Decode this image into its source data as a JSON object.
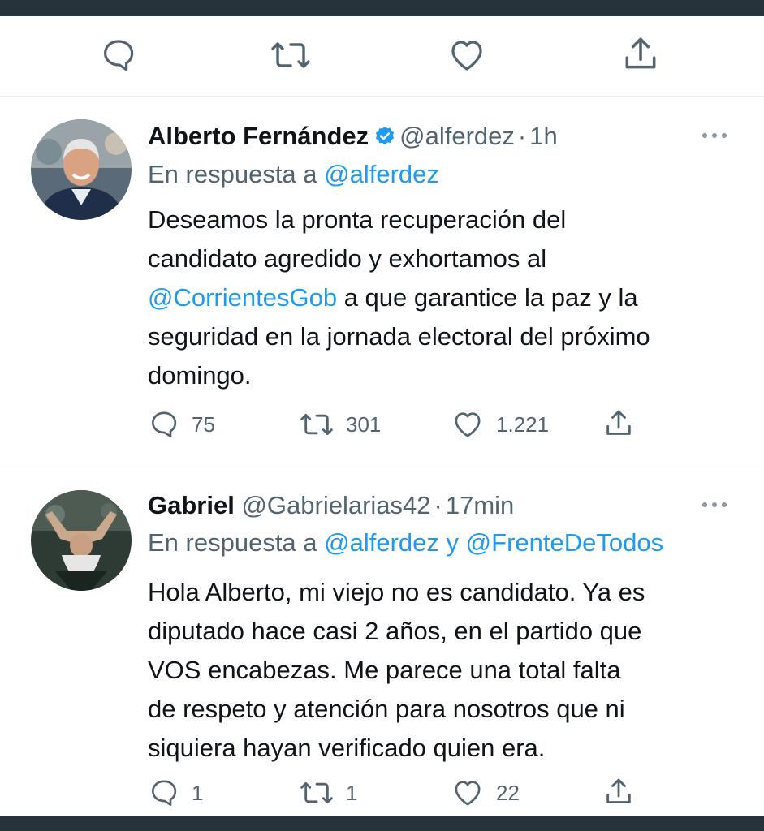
{
  "top_actions": {
    "icons": [
      "reply-icon",
      "retweet-icon",
      "like-icon",
      "share-icon"
    ]
  },
  "tweets": [
    {
      "author_name": "Alberto Fernández",
      "verified": true,
      "handle": "@alferdez",
      "separator": "·",
      "time": "1h",
      "reply_prefix": "En respuesta a",
      "reply_to": "@alferdez",
      "reply_joiner": "",
      "reply_to_2": "",
      "text_lines": [
        "Deseamos la pronta recuperación del",
        "candidato agredido y exhortamos al",
        "a que garantice la paz y la",
        "seguridad en la jornada electoral del próximo",
        "domingo."
      ],
      "mention": "@CorrientesGob",
      "stats": {
        "replies": "75",
        "retweets": "301",
        "likes": "1.221"
      }
    },
    {
      "author_name": "Gabriel",
      "verified": false,
      "handle": "@Gabrielarias42",
      "separator": "·",
      "time": "17min",
      "reply_prefix": "En respuesta a",
      "reply_to": "@alferdez",
      "reply_joiner": "y",
      "reply_to_2": "@FrenteDeTodos",
      "text_lines": [
        "Hola Alberto, mi viejo no es candidato. Ya es",
        "diputado hace casi 2 años, en el partido que",
        "VOS encabezas. Me parece una total falta",
        "de respeto y atención para nosotros que ni",
        "siquiera hayan verificado quien era."
      ],
      "stats": {
        "replies": "1",
        "retweets": "1",
        "likes": "22"
      }
    }
  ],
  "colors": {
    "link": "#1d9bf0",
    "secondary_text": "#536471",
    "primary_text": "#0f1419",
    "verified_badge": "#1d9bf0",
    "frame_bar": "#26333a"
  }
}
